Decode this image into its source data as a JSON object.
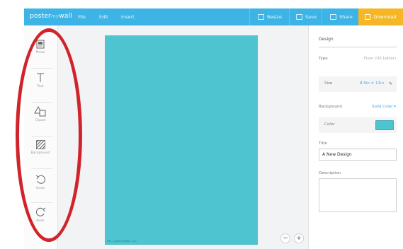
{
  "brand": {
    "part1": "poster",
    "part2": "my",
    "part3": "wall"
  },
  "menu": {
    "file": "File",
    "edit": "Edit",
    "insert": "Insert"
  },
  "topbar": {
    "resize": "Resize",
    "save": "Save",
    "share": "Share",
    "download": "Download"
  },
  "tools": [
    {
      "label": "Photo",
      "icon": "image-icon"
    },
    {
      "label": "Text",
      "icon": "text-icon"
    },
    {
      "label": "Clipart",
      "icon": "shapes-icon"
    },
    {
      "label": "Background",
      "icon": "background-icon"
    },
    {
      "label": "Undo",
      "icon": "undo-icon"
    },
    {
      "label": "Redo",
      "icon": "redo-icon"
    }
  ],
  "canvas": {
    "footer": "File - posterMyWall - s.p"
  },
  "zoom": {
    "minus": "−",
    "plus": "+"
  },
  "panel": {
    "title": "Design",
    "type_label": "Type",
    "type_value": "Flyer (US Letter)",
    "size_label": "Size",
    "size_value": "8.5in × 11in",
    "background_label": "Background",
    "background_value": "Solid Color ▾",
    "color_label": "Color",
    "title_label": "Title",
    "title_value": "A New Design",
    "description_label": "Description",
    "description_value": ""
  },
  "colors": {
    "topbar": "#3eb4e6",
    "download": "#f5b726",
    "page": "#4dc4d0",
    "annotation": "#d1232a"
  }
}
